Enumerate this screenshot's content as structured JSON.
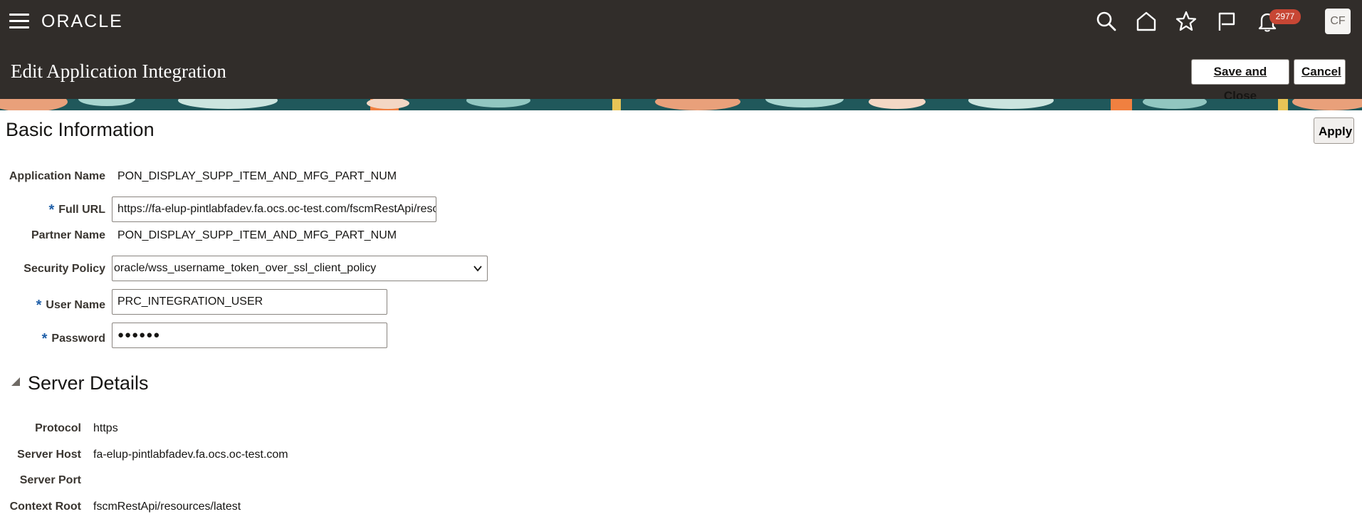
{
  "topbar": {
    "logo": "ORACLE",
    "notification_count": "2977",
    "avatar_initials": "CF",
    "icons": [
      "menu-icon",
      "search-icon",
      "home-icon",
      "star-icon",
      "flag-icon",
      "bell-icon"
    ]
  },
  "header": {
    "title": "Edit Application Integration",
    "save_close_label": "Save and Close",
    "cancel_label": "Cancel"
  },
  "basic": {
    "title": "Basic Information",
    "apply_label": "Apply",
    "app_name_label": "Application Name",
    "app_name_value": "PON_DISPLAY_SUPP_ITEM_AND_MFG_PART_NUM",
    "full_url_label": "Full URL",
    "full_url_value": "https://fa-elup-pintlabfadev.fa.ocs.oc-test.com/fscmRestApi/reso",
    "partner_name_label": "Partner Name",
    "partner_name_value": "PON_DISPLAY_SUPP_ITEM_AND_MFG_PART_NUM",
    "security_policy_label": "Security Policy",
    "security_policy_value": "oracle/wss_username_token_over_ssl_client_policy",
    "user_name_label": "User Name",
    "user_name_value": "PRC_INTEGRATION_USER",
    "password_label": "Password",
    "password_value": "●●●●●●",
    "required_mark": "*"
  },
  "server": {
    "title": "Server Details",
    "protocol_label": "Protocol",
    "protocol_value": "https",
    "host_label": "Server Host",
    "host_value": "fa-elup-pintlabfadev.fa.ocs.oc-test.com",
    "port_label": "Server Port",
    "port_value": "",
    "context_label": "Context Root",
    "context_value": "fscmRestApi/resources/latest"
  },
  "colors": {
    "header_bg": "#312d2a",
    "badge": "#c74634",
    "required": "#1f5fa8"
  }
}
